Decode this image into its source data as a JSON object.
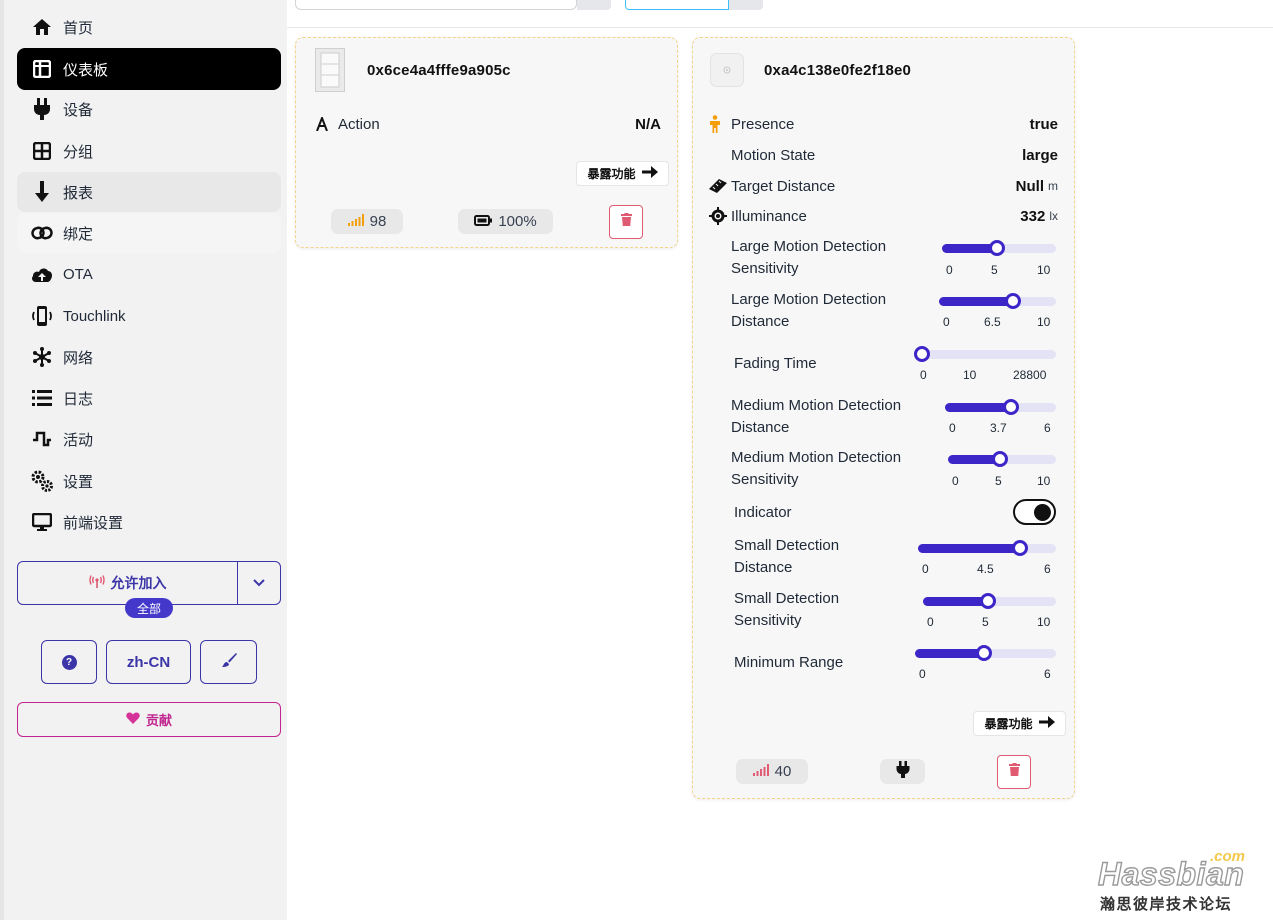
{
  "sidebar": {
    "items": [
      {
        "label": "首页",
        "icon": "home-icon"
      },
      {
        "label": "仪表板",
        "icon": "dashboard-icon"
      },
      {
        "label": "设备",
        "icon": "plug-icon"
      },
      {
        "label": "分组",
        "icon": "groups-icon"
      },
      {
        "label": "报表",
        "icon": "arrow-down-icon"
      },
      {
        "label": "绑定",
        "icon": "link-icon"
      },
      {
        "label": "OTA",
        "icon": "cloud-upload-icon"
      },
      {
        "label": "Touchlink",
        "icon": "touchlink-icon"
      },
      {
        "label": "网络",
        "icon": "network-icon"
      },
      {
        "label": "日志",
        "icon": "list-icon"
      },
      {
        "label": "活动",
        "icon": "activity-icon"
      },
      {
        "label": "设置",
        "icon": "cogs-icon"
      },
      {
        "label": "前端设置",
        "icon": "monitor-icon"
      }
    ],
    "permit_join": {
      "label": "允许加入",
      "target_badge": "全部"
    },
    "help_label": "?",
    "language": "zh-CN",
    "contribute_label": "贡献"
  },
  "cards": [
    {
      "title": "0x6ce4a4fffe9a905c",
      "rows": [
        {
          "label": "Action",
          "value": "N/A"
        }
      ],
      "expose_label": "暴露功能",
      "linkquality": "98",
      "battery": "100%"
    },
    {
      "title": "0xa4c138e0fe2f18e0",
      "rows": [
        {
          "label": "Presence",
          "value": "true",
          "unit": ""
        },
        {
          "label": "Motion State",
          "value": "large",
          "unit": ""
        },
        {
          "label": "Target Distance",
          "value": "Null",
          "unit": "m"
        },
        {
          "label": "Illuminance",
          "value": "332",
          "unit": "lx"
        }
      ],
      "sliders": [
        {
          "label_line1": "Large Motion Detection",
          "label_line2": "Sensitivity",
          "min": "0",
          "value": "5",
          "max": "10",
          "fraction": 0.5
        },
        {
          "label_line1": "Large Motion Detection",
          "label_line2": "Distance",
          "min": "0",
          "value": "6.5",
          "max": "10",
          "fraction": 0.65
        },
        {
          "label_line1": "Fading Time",
          "label_line2": "",
          "min": "0",
          "value": "10",
          "max": "28800",
          "fraction": 0.0003
        },
        {
          "label_line1": "Medium Motion Detection",
          "label_line2": "Distance",
          "min": "0",
          "value": "3.7",
          "max": "6",
          "fraction": 0.617
        },
        {
          "label_line1": "Medium Motion Detection",
          "label_line2": "Sensitivity",
          "min": "0",
          "value": "5",
          "max": "10",
          "fraction": 0.5
        },
        {
          "label_line1": "Small Detection",
          "label_line2": "Distance",
          "min": "0",
          "value": "4.5",
          "max": "6",
          "fraction": 0.75
        },
        {
          "label_line1": "Small Detection",
          "label_line2": "Sensitivity",
          "min": "0",
          "value": "5",
          "max": "10",
          "fraction": 0.5
        },
        {
          "label_line1": "Minimum Range",
          "label_line2": "",
          "min": "0",
          "value": "",
          "max": "6",
          "fraction": 0.5
        }
      ],
      "indicator_label": "Indicator",
      "indicator_on": true,
      "expose_label": "暴露功能",
      "linkquality": "40"
    }
  ],
  "colors": {
    "accent": "#3d26c8",
    "active_nav": "#000000",
    "danger": "#e05a72",
    "contribute": "#c0268f",
    "presence": "#f59e0b"
  },
  "watermark": {
    "brand": "Hassbian",
    "domain": ".com",
    "tagline": "瀚思彼岸技术论坛"
  }
}
